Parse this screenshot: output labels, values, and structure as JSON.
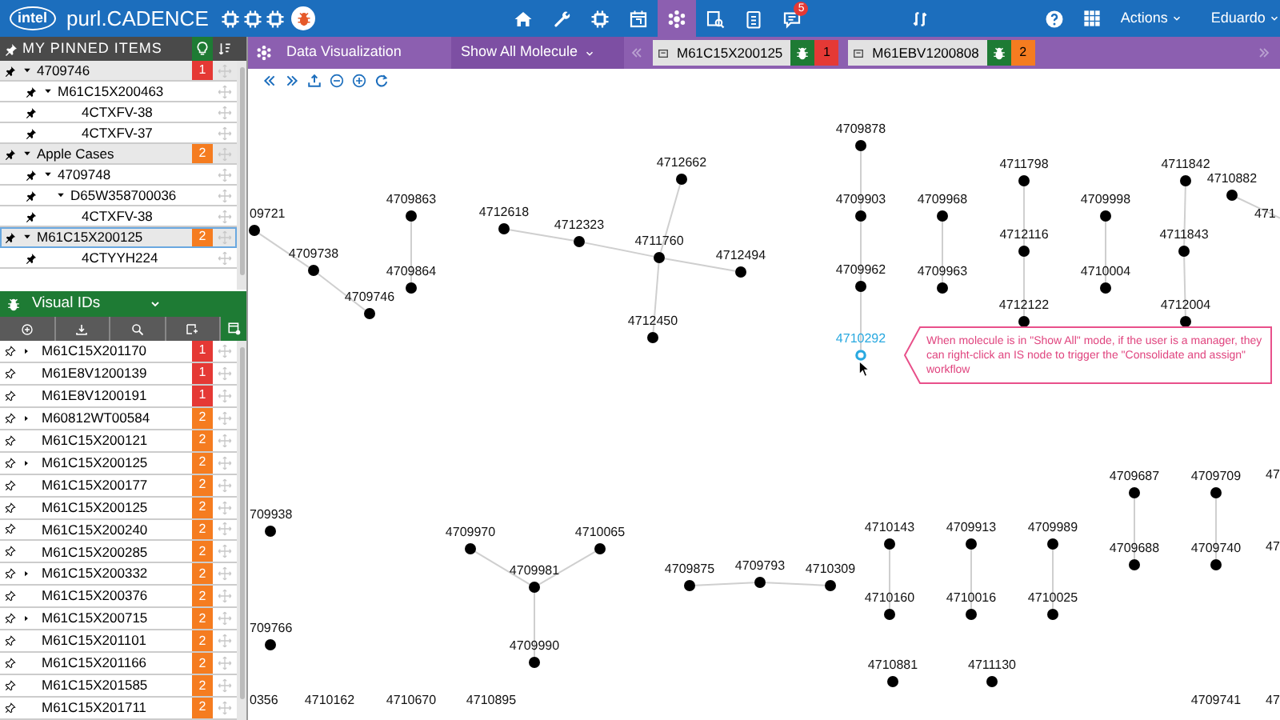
{
  "app": {
    "logo": "intel",
    "title": "purl.CADENCE"
  },
  "nav": [
    {
      "selected": false
    },
    {
      "selected": false
    },
    {
      "selected": false
    },
    {
      "selected": false
    },
    {
      "selected": true
    },
    {
      "selected": false
    },
    {
      "selected": false
    },
    {
      "selected": false,
      "badge": "5"
    }
  ],
  "menus": [
    "Actions",
    "Eduardo"
  ],
  "view": {
    "title": "Data Visualization",
    "mode": "Show All Molecule"
  },
  "open_tabs": [
    {
      "label": "M61C15X200125",
      "count": "1",
      "color": "#e53935"
    },
    {
      "label": "M61EBV1200808",
      "count": "2",
      "color": "#f57c20"
    }
  ],
  "pinned": {
    "title": "MY PINNED ITEMS",
    "items": [
      {
        "label": "4709746",
        "count": "1",
        "color": "#e53935",
        "selected": false,
        "expanded": true,
        "children": [
          {
            "label": "M61C15X200463",
            "selected": false,
            "expanded": true,
            "children": [
              {
                "label": "4CTXFV-38",
                "selected": false
              },
              {
                "label": "4CTXFV-37",
                "selected": false
              }
            ]
          }
        ]
      },
      {
        "label": "Apple Cases",
        "count": "2",
        "color": "#f57c20",
        "selected": false,
        "expanded": true,
        "children": [
          {
            "label": "4709748",
            "selected": false,
            "expanded": true,
            "children": [
              {
                "label": "D65W358700036",
                "selected": false,
                "expanded": true,
                "children": [
                  {
                    "label": "4CTXFV-38",
                    "selected": false
                  }
                ]
              }
            ]
          }
        ]
      },
      {
        "label": "M61C15X200125",
        "count": "2",
        "color": "#f57c20",
        "selected": true,
        "expanded": true,
        "children": [
          {
            "label": "4CTYYH224",
            "selected": false
          }
        ]
      }
    ]
  },
  "visual_ids": {
    "title": "Visual IDs",
    "items": [
      {
        "label": "M61C15X201170",
        "count": "1",
        "color": "#e53935",
        "expandable": true
      },
      {
        "label": "M61E8V1200139",
        "count": "1",
        "color": "#e53935",
        "expandable": false
      },
      {
        "label": "M61E8V1200191",
        "count": "1",
        "color": "#e53935",
        "expandable": false
      },
      {
        "label": "M60812WT00584",
        "count": "2",
        "color": "#f57c20",
        "expandable": true
      },
      {
        "label": "M61C15X200121",
        "count": "2",
        "color": "#f57c20",
        "expandable": false
      },
      {
        "label": "M61C15X200125",
        "count": "2",
        "color": "#f57c20",
        "expandable": true
      },
      {
        "label": "M61C15X200177",
        "count": "2",
        "color": "#f57c20",
        "expandable": false
      },
      {
        "label": "M61C15X200125",
        "count": "2",
        "color": "#f57c20",
        "expandable": false
      },
      {
        "label": "M61C15X200240",
        "count": "2",
        "color": "#f57c20",
        "expandable": false
      },
      {
        "label": "M61C15X200285",
        "count": "2",
        "color": "#f57c20",
        "expandable": false
      },
      {
        "label": "M61C15X200332",
        "count": "2",
        "color": "#f57c20",
        "expandable": true
      },
      {
        "label": "M61C15X200376",
        "count": "2",
        "color": "#f57c20",
        "expandable": false
      },
      {
        "label": "M61C15X200715",
        "count": "2",
        "color": "#f57c20",
        "expandable": true
      },
      {
        "label": "M61C15X201101",
        "count": "2",
        "color": "#f57c20",
        "expandable": false
      },
      {
        "label": "M61C15X201166",
        "count": "2",
        "color": "#f57c20",
        "expandable": false
      },
      {
        "label": "M61C15X201585",
        "count": "2",
        "color": "#f57c20",
        "expandable": false
      },
      {
        "label": "M61C15X201711",
        "count": "2",
        "color": "#f57c20",
        "expandable": false
      }
    ]
  },
  "graph": {
    "nodes": [
      {
        "label": "09721",
        "selected": false
      },
      {
        "label": "4709738",
        "selected": false
      },
      {
        "label": "4709746",
        "selected": false
      },
      {
        "label": "4709863",
        "selected": false
      },
      {
        "label": "4709864",
        "selected": false
      },
      {
        "label": "4712618",
        "selected": false
      },
      {
        "label": "4712323",
        "selected": false
      },
      {
        "label": "4711760",
        "selected": false
      },
      {
        "label": "4712494",
        "selected": false
      },
      {
        "label": "4712662",
        "selected": false
      },
      {
        "label": "4712450",
        "selected": false
      },
      {
        "label": "4709878",
        "selected": false
      },
      {
        "label": "4709903",
        "selected": false
      },
      {
        "label": "4709962",
        "selected": false
      },
      {
        "label": "4710292",
        "selected": true
      },
      {
        "label": "4709968",
        "selected": false
      },
      {
        "label": "4709963",
        "selected": false
      },
      {
        "label": "4711798",
        "selected": false
      },
      {
        "label": "4712116",
        "selected": false
      },
      {
        "label": "4712122",
        "selected": false
      },
      {
        "label": "4709998",
        "selected": false
      },
      {
        "label": "4710004",
        "selected": false
      },
      {
        "label": "4711842",
        "selected": false
      },
      {
        "label": "4711843",
        "selected": false
      },
      {
        "label": "4712004",
        "selected": false
      },
      {
        "label": "4710882",
        "selected": false
      },
      {
        "label": "471",
        "selected": false
      },
      {
        "label": "709938",
        "selected": false
      },
      {
        "label": "4709970",
        "selected": false
      },
      {
        "label": "4710065",
        "selected": false
      },
      {
        "label": "4709981",
        "selected": false
      },
      {
        "label": "4709990",
        "selected": false
      },
      {
        "label": "4709875",
        "selected": false
      },
      {
        "label": "4709793",
        "selected": false
      },
      {
        "label": "4710309",
        "selected": false
      },
      {
        "label": "4710143",
        "selected": false
      },
      {
        "label": "4710160",
        "selected": false
      },
      {
        "label": "4709913",
        "selected": false
      },
      {
        "label": "4710016",
        "selected": false
      },
      {
        "label": "4709989",
        "selected": false
      },
      {
        "label": "4710025",
        "selected": false
      },
      {
        "label": "4709687",
        "selected": false
      },
      {
        "label": "4709688",
        "selected": false
      },
      {
        "label": "4709709",
        "selected": false
      },
      {
        "label": "4709740",
        "selected": false
      },
      {
        "label": "47",
        "selected": false
      },
      {
        "label": "47",
        "selected": false
      },
      {
        "label": "709766",
        "selected": false
      },
      {
        "label": "4710881",
        "selected": false
      },
      {
        "label": "4711130",
        "selected": false
      },
      {
        "label": "0356",
        "selected": false
      },
      {
        "label": "4710162",
        "selected": false
      },
      {
        "label": "4710670",
        "selected": false
      },
      {
        "label": "4710895",
        "selected": false
      },
      {
        "label": "4709741",
        "selected": false
      },
      {
        "label": "47",
        "selected": false
      }
    ],
    "note": "When molecule is in \"Show All\" mode, if the user is a manager, they can right-click an IS node to trigger the \"Consolidate and assign\" workflow"
  }
}
